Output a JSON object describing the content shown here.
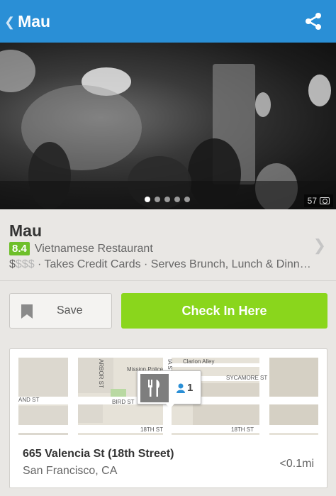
{
  "action_bar": {
    "title": "Mau",
    "back_icon": "chevron-left-icon",
    "share_icon": "share-icon",
    "color": "#2a8fd6"
  },
  "hero": {
    "photo_count": "57",
    "camera_icon": "camera-icon",
    "pager_dots": 5,
    "active_dot": 0
  },
  "venue": {
    "name": "Mau",
    "score": "8.4",
    "score_color": "#6ebf2a",
    "category": "Vietnamese Restaurant",
    "price_on": "$",
    "price_off": "$$$",
    "attributes": " · Takes Credit Cards · Serves Brunch, Lunch & Dinn…",
    "chevron_icon": "chevron-right-icon"
  },
  "actions": {
    "save_label": "Save",
    "bookmark_icon": "bookmark-icon",
    "checkin_label": "Check In Here",
    "checkin_color": "#8ad61c"
  },
  "map": {
    "streets": [
      "ARBOR ST",
      "Mission Police",
      "IA ST",
      "Clarion Alley",
      "SYCAMORE ST",
      "AND ST",
      "BIRD ST",
      "18TH ST",
      "18TH ST"
    ],
    "pin_icon": "fork-knife-icon",
    "friends_icon": "person-icon",
    "friends_count": "1",
    "address_line1": "665 Valencia St (18th Street)",
    "address_line2": "San Francisco, CA",
    "distance": "<0.1mi"
  }
}
